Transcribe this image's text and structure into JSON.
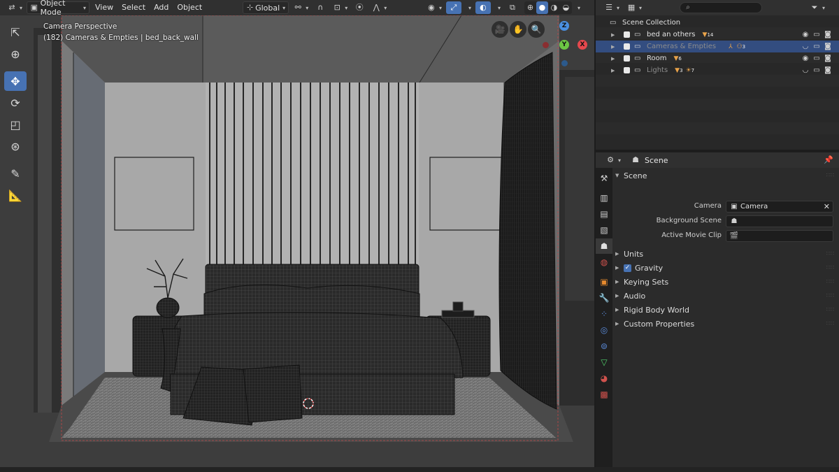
{
  "header": {
    "mode": "Object Mode",
    "menus": [
      "View",
      "Select",
      "Add",
      "Object"
    ],
    "orientation": "Global"
  },
  "viewport": {
    "info_line1": "Camera Perspective",
    "info_line2": "(182) Cameras & Empties | bed_back_wall",
    "gizmo": {
      "z": "Z",
      "y": "Y",
      "x": "X"
    }
  },
  "outliner": {
    "root": "Scene Collection",
    "collections": [
      {
        "label": "bed an others",
        "badge": "14",
        "selected": false,
        "dim": false
      },
      {
        "label": "Cameras & Empties",
        "badge": "3",
        "selected": true,
        "dim": true
      },
      {
        "label": "Room",
        "badge": "6",
        "selected": false,
        "dim": false
      },
      {
        "label": "Lights",
        "badge": "3",
        "badge2": "7",
        "selected": false,
        "dim": true
      }
    ]
  },
  "properties": {
    "header_title": "Scene",
    "panel_title": "Scene",
    "camera_label": "Camera",
    "camera_value": "Camera",
    "background_scene_label": "Background Scene",
    "background_scene_value": "",
    "active_movie_clip_label": "Active Movie Clip",
    "active_movie_clip_value": "",
    "subpanels": {
      "units": "Units",
      "gravity": "Gravity",
      "keying_sets": "Keying Sets",
      "audio": "Audio",
      "rigid_body_world": "Rigid Body World",
      "custom_properties": "Custom Properties"
    }
  },
  "colors": {
    "accent": "#4772b3",
    "selection_row": "#334d80",
    "gizmo_x": "#e5484d",
    "gizmo_y": "#6cc644",
    "gizmo_z": "#4a8fe0"
  }
}
